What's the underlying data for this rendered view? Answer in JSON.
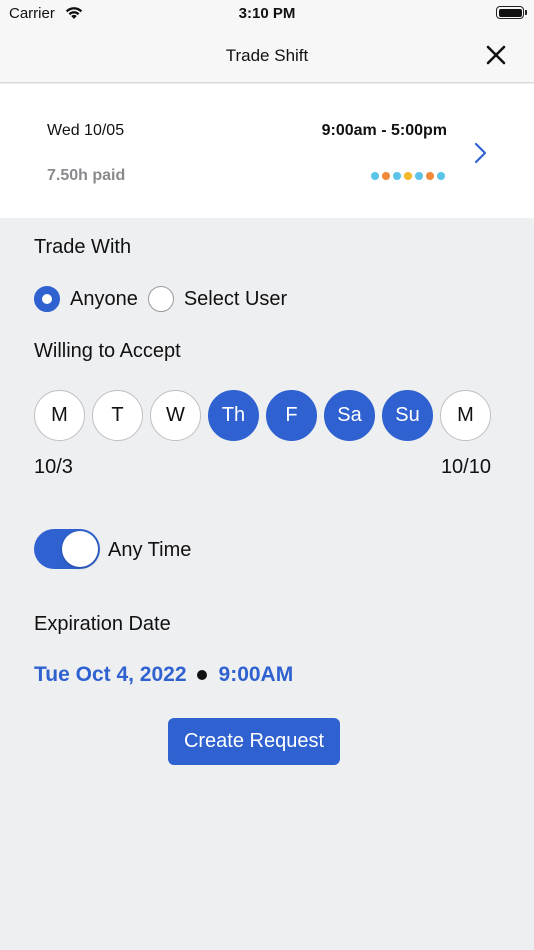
{
  "status_bar": {
    "carrier": "Carrier",
    "time": "3:10 PM"
  },
  "nav": {
    "title": "Trade Shift"
  },
  "shift": {
    "date": "Wed 10/05",
    "time_range": "9:00am - 5:00pm",
    "paid": "7.50h paid",
    "dot_colors": [
      "#5bc4e8",
      "#f08a3c",
      "#5bc4e8",
      "#f5b928",
      "#5bc4e8",
      "#f08a3c",
      "#5bc4e8"
    ]
  },
  "trade_with": {
    "label": "Trade With",
    "options": [
      "Anyone",
      "Select User"
    ],
    "selected": "Anyone"
  },
  "willing": {
    "label": "Willing to Accept",
    "days": [
      {
        "label": "M",
        "selected": false
      },
      {
        "label": "T",
        "selected": false
      },
      {
        "label": "W",
        "selected": false
      },
      {
        "label": "Th",
        "selected": true
      },
      {
        "label": "F",
        "selected": true
      },
      {
        "label": "Sa",
        "selected": true
      },
      {
        "label": "Su",
        "selected": true
      },
      {
        "label": "M",
        "selected": false
      }
    ],
    "range_start": "10/3",
    "range_end": "10/10"
  },
  "any_time": {
    "label": "Any Time",
    "on": true
  },
  "expiration": {
    "label": "Expiration Date",
    "date": "Tue Oct 4, 2022",
    "time": "9:00AM"
  },
  "actions": {
    "create_label": "Create Request"
  },
  "colors": {
    "accent": "#2f62d0"
  }
}
